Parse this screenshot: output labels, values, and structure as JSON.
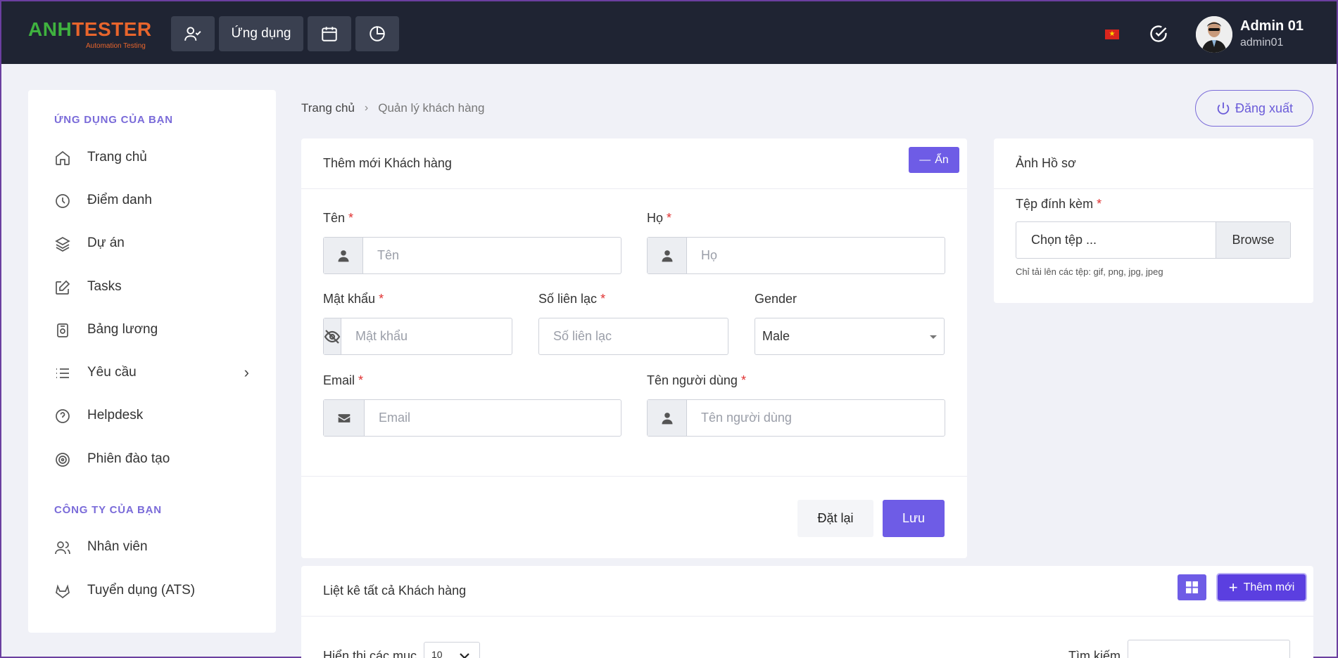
{
  "header": {
    "logo_brand_a": "ANH",
    "logo_brand_b": "TESTER",
    "logo_tagline": "Automation Testing",
    "apps_button_label": "Ứng dụng",
    "user_name": "Admin 01",
    "user_login": "admin01",
    "flag_star": "★"
  },
  "sidebar": {
    "section_apps": "ỨNG DỤNG CỦA BẠN",
    "section_company": "CÔNG TY CỦA BẠN",
    "items": [
      {
        "label": "Trang chủ",
        "icon": "home-icon"
      },
      {
        "label": "Điểm danh",
        "icon": "clock-icon"
      },
      {
        "label": "Dự án",
        "icon": "layers-icon"
      },
      {
        "label": "Tasks",
        "icon": "edit-icon"
      },
      {
        "label": "Bảng lương",
        "icon": "payslip-icon"
      },
      {
        "label": "Yêu cầu",
        "icon": "list-icon"
      },
      {
        "label": "Helpdesk",
        "icon": "help-circle-icon"
      },
      {
        "label": "Phiên đào tạo",
        "icon": "target-icon"
      },
      {
        "label": "Nhân viên",
        "icon": "users-icon"
      },
      {
        "label": "Tuyển dụng (ATS)",
        "icon": "gitlab-icon"
      }
    ],
    "chevron": "›"
  },
  "breadcrumb": {
    "home": "Trang chủ",
    "separator": "›",
    "current": "Quản lý khách hàng"
  },
  "logout_label": "Đăng xuất",
  "add_form": {
    "title": "Thêm mới Khách hàng",
    "hide_label": "Ẩn",
    "hide_dash": "—",
    "fields": {
      "first_name": {
        "label": "Tên",
        "placeholder": "Tên"
      },
      "last_name": {
        "label": "Họ",
        "placeholder": "Họ"
      },
      "password": {
        "label": "Mật khẩu",
        "placeholder": "Mật khẩu"
      },
      "contact": {
        "label": "Số liên lạc",
        "placeholder": "Số liên lạc"
      },
      "gender": {
        "label": "Gender",
        "value": "Male"
      },
      "email": {
        "label": "Email",
        "placeholder": "Email"
      },
      "username": {
        "label": "Tên người dùng",
        "placeholder": "Tên người dùng"
      }
    },
    "required_mark": "*",
    "reset_label": "Đặt lại",
    "save_label": "Lưu"
  },
  "profile_card": {
    "title": "Ảnh Hồ sơ",
    "attachment_label": "Tệp đính kèm",
    "file_placeholder": "Chọn tệp ...",
    "browse_label": "Browse",
    "hint": "Chỉ tải lên các tệp: gif, png, jpg, jpeg"
  },
  "list_card": {
    "title": "Liệt kê tất cả Khách hàng",
    "add_new_label": "Thêm mới",
    "add_plus": "+",
    "show_entries_label": "Hiển thị các mục",
    "page_size": "10",
    "search_label": "Tìm kiếm"
  },
  "colors": {
    "accent": "#6e5ce6",
    "topbar": "#1f2433",
    "required": "#e03131"
  }
}
